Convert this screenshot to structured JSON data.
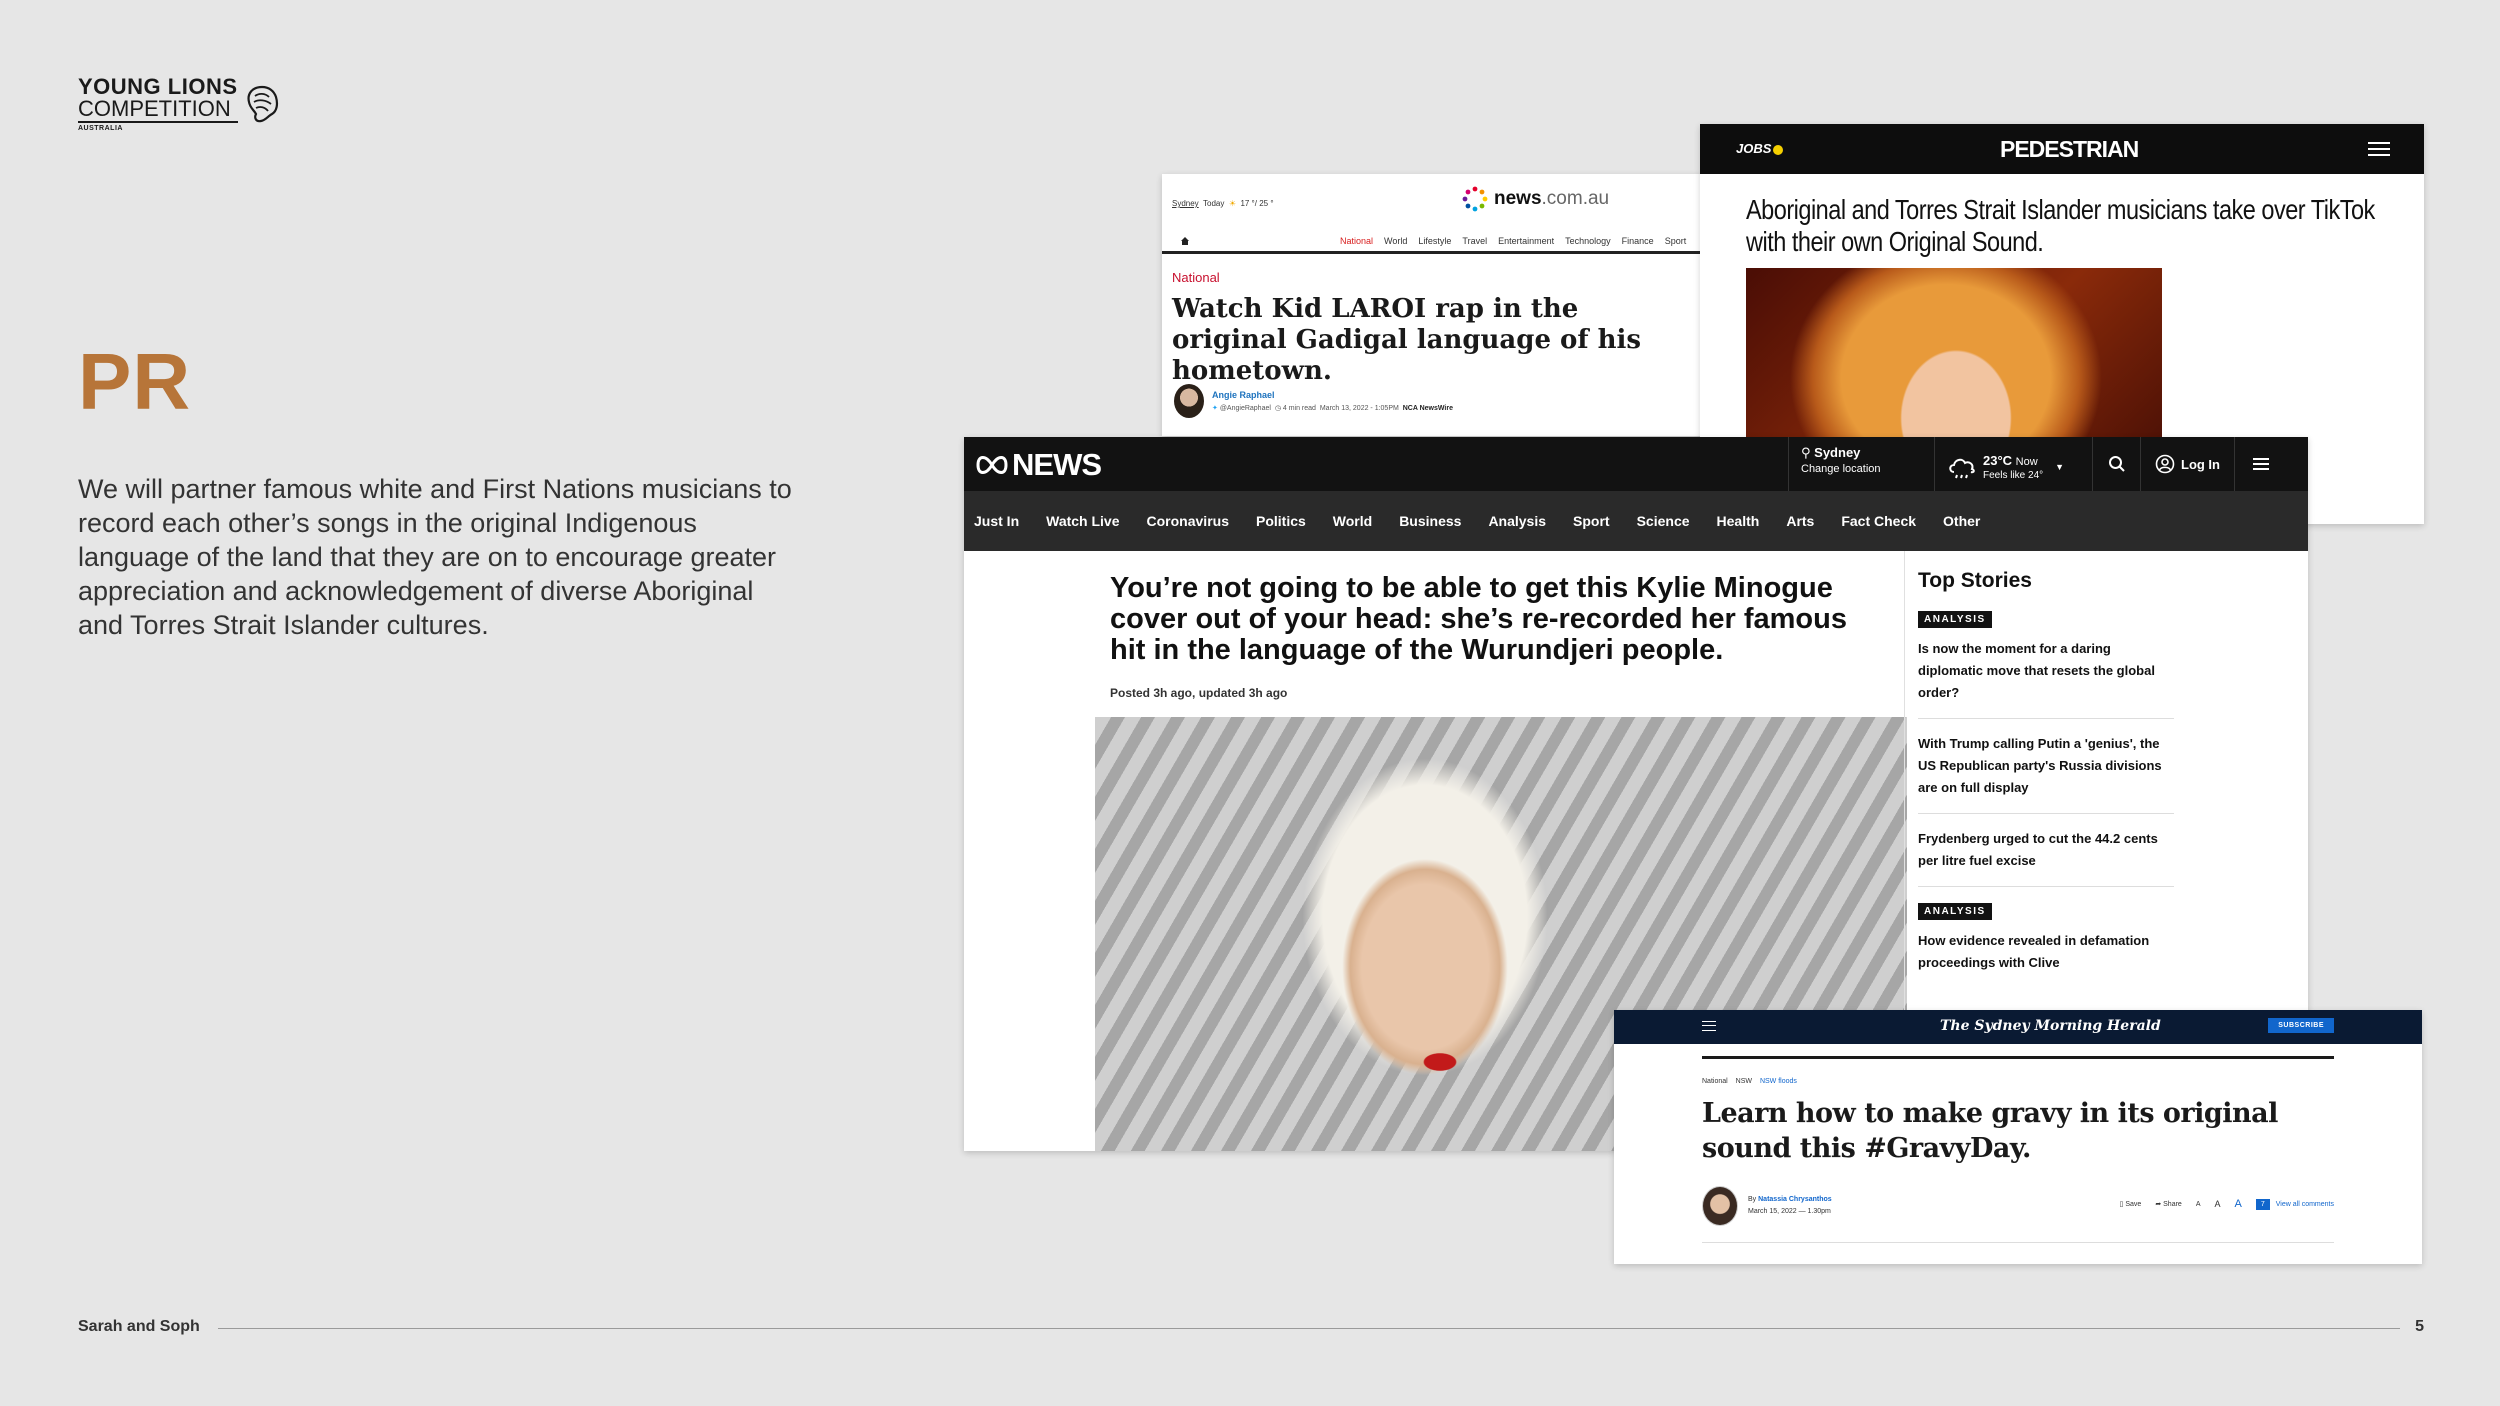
{
  "logo": {
    "line1": "YOUNG LIONS",
    "line2": "COMPETITION",
    "line3": "AUSTRALIA"
  },
  "slide": {
    "title": "PR",
    "body": "We will partner famous white and First Nations musicians to record each other’s songs in the original Indigenous language of the land that they are on to encourage greater appreciation and acknowledgement of diverse Aboriginal and Torres Strait Islander cultures.",
    "accent_color": "#b77539",
    "background": "#e6e6e6"
  },
  "footer": {
    "authors": "Sarah and Soph",
    "page": "5"
  },
  "newscomau": {
    "location": "Sydney",
    "today": "Today",
    "weather": "17 °/ 25 °",
    "logo_main": "news",
    "logo_suffix": ".com.au",
    "nav": [
      "National",
      "World",
      "Lifestyle",
      "Travel",
      "Entertainment",
      "Technology",
      "Finance",
      "Sport"
    ],
    "section": "National",
    "headline": "Watch Kid LAROI rap in the original Gadigal language of his hometown.",
    "author": "Angie Raphael",
    "handle": "@AngieRaphael",
    "read_time": "4 min read",
    "date": "March 13, 2022 - 1:05PM",
    "source": "NCA NewsWire"
  },
  "pedestrian": {
    "jobs_label": "JOBS",
    "logo": "PEDESTRIAN",
    "headline": "Aboriginal and Torres Strait Islander musicians take over TikTok with their own Original Sound."
  },
  "abc": {
    "logo": "NEWS",
    "location": "Sydney",
    "change_location": "Change location",
    "temperature": "23°C",
    "now_label": "Now",
    "feels_like": "Feels like 24°",
    "login": "Log In",
    "nav": [
      "Just In",
      "Watch Live",
      "Coronavirus",
      "Politics",
      "World",
      "Business",
      "Analysis",
      "Sport",
      "Science",
      "Health",
      "Arts",
      "Fact Check",
      "Other"
    ],
    "headline": "You’re not going to be able to get this Kylie Minogue cover out of your head: she’s re-recorded her famous hit in the language of the Wurundjeri people.",
    "posted": "Posted 3h ago,",
    "updated": "updated 3h ago",
    "top_stories_title": "Top Stories",
    "top_stories": [
      {
        "badge": "ANALYSIS",
        "text": "Is now the moment for a daring diplomatic move that resets the global order?"
      },
      {
        "badge": "",
        "text": "With Trump calling Putin a 'genius', the US Republican party's Russia divisions are on full display"
      },
      {
        "badge": "",
        "text": "Frydenberg urged to cut the 44.2 cents per litre fuel excise"
      },
      {
        "badge": "ANALYSIS",
        "text": "How evidence revealed in defamation proceedings with Clive"
      }
    ]
  },
  "smh": {
    "logo": "The Sydney Morning Herald",
    "subscribe": "SUBSCRIBE",
    "crumbs": [
      "National",
      "NSW",
      "NSW floods"
    ],
    "headline": "Learn how to make gravy in its original sound this #GravyDay.",
    "byline_prefix": "By",
    "author": "Natassia Chrysanthos",
    "date": "March 15, 2022 — 1.30pm",
    "save": "Save",
    "share": "Share",
    "text_size_labels": [
      "A",
      "A",
      "A"
    ],
    "comments_count": "7",
    "view_comments": "View all comments"
  }
}
